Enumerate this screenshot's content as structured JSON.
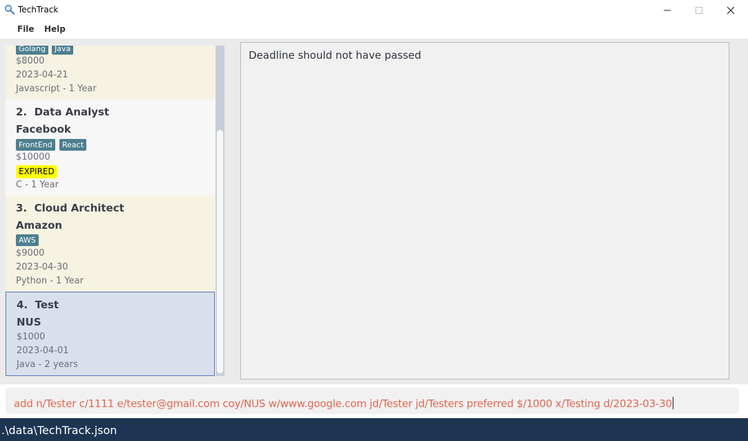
{
  "window": {
    "title": "TechTrack"
  },
  "menu": {
    "file": "File",
    "help": "Help"
  },
  "list": {
    "cards": [
      {
        "index_title": "",
        "company": "",
        "tags": [
          "Golang",
          "Java"
        ],
        "salary": "$8000",
        "deadline": "2023-04-21",
        "experience": "Javascript - 1 Year"
      },
      {
        "index_title": "2.  Data Analyst",
        "company": "Facebook",
        "tags": [
          "FrontEnd",
          "React"
        ],
        "salary": "$10000",
        "status": "EXPIRED",
        "experience": "C - 1 Year"
      },
      {
        "index_title": "3.  Cloud Architect",
        "company": "Amazon",
        "tags": [
          "AWS"
        ],
        "salary": "$9000",
        "deadline": "2023-04-30",
        "experience": "Python - 1 Year"
      },
      {
        "index_title": "4.  Test",
        "company": "NUS",
        "tags": [],
        "salary": "$1000",
        "deadline": "2023-04-01",
        "experience": "Java - 2 years"
      }
    ]
  },
  "result": {
    "message": "Deadline should not have passed"
  },
  "command": {
    "value": "add n/Tester c/1111 e/tester@gmail.com coy/NUS w/www.google.com jd/Tester jd/Testers preferred $/1000 x/Testing d/2023-03-30"
  },
  "status": {
    "path": ".\\data\\TechTrack.json"
  },
  "colors": {
    "tag": "#4d7f8f",
    "expired": "#ffff00",
    "command_text": "#e06850",
    "statusbar": "#1d3453",
    "selected_card": "#d9e0ec"
  },
  "icons": {
    "app": "magnifier-icon",
    "minimize": "minimize-icon",
    "maximize": "maximize-icon",
    "close": "close-icon"
  }
}
